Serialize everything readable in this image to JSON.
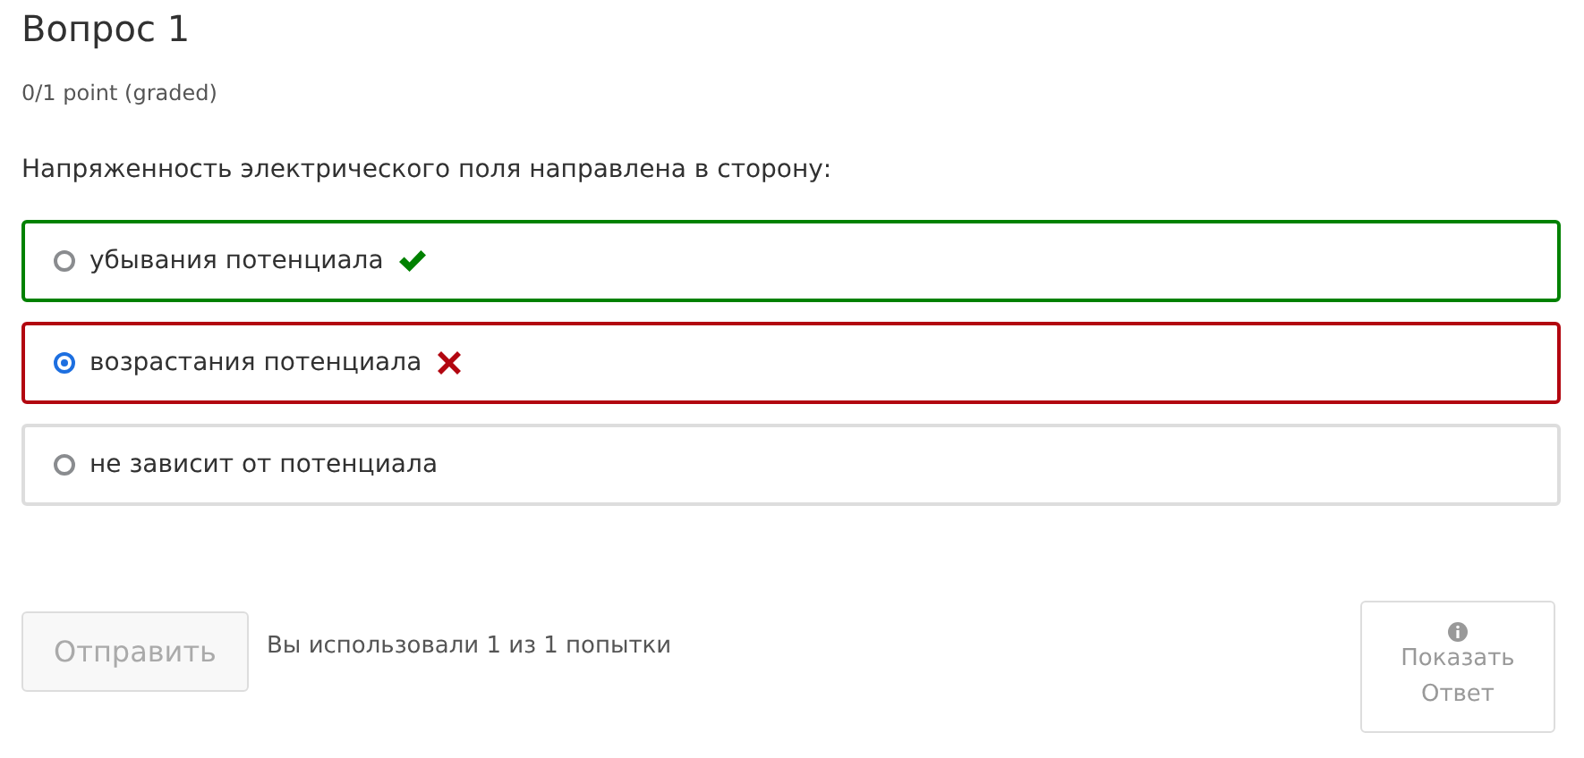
{
  "title": "Вопрос 1",
  "score": "0/1 point (graded)",
  "question": "Напряженность электрического поля направлена в сторону:",
  "options": [
    {
      "label": "убывания потенциала",
      "selected": false,
      "kind": "correct"
    },
    {
      "label": "возрастания потенциала",
      "selected": true,
      "kind": "incorrect"
    },
    {
      "label": "не зависит от потенциала",
      "selected": false,
      "kind": "plain"
    }
  ],
  "submit": {
    "label": "Отправить",
    "disabled": true
  },
  "attempts": "Вы использовали 1 из 1 попытки",
  "show_answer": {
    "label_lines": [
      "Показать",
      "Ответ"
    ],
    "disabled": true
  }
}
